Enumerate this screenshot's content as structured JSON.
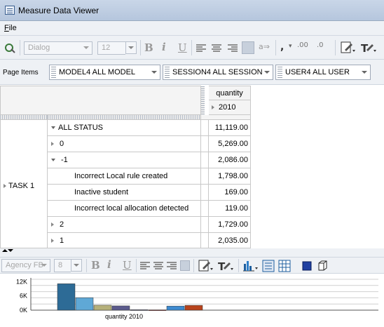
{
  "window": {
    "title": "Measure Data Viewer",
    "icon": "measure-viewer-icon"
  },
  "menu": {
    "file": "File"
  },
  "toolbar": {
    "font_name": "Dialog",
    "font_size": "12",
    "bold": "B",
    "italic": "i",
    "underline": "U"
  },
  "page_items": {
    "label": "Page Items",
    "model": "MODEL4  ALL MODEL",
    "session": "SESSION4  ALL SESSION",
    "user": "USER4  ALL USER"
  },
  "grid": {
    "measure": "quantity",
    "year": "2010",
    "task": "TASK 1",
    "rows": [
      {
        "label": "ALL STATUS",
        "value": "11,119.00"
      },
      {
        "label": "0",
        "value": "5,269.00"
      },
      {
        "label": "-1",
        "value": "2,086.00"
      },
      {
        "label": "Incorrect Local rule created",
        "value": "1,798.00"
      },
      {
        "label": "Inactive student",
        "value": "169.00"
      },
      {
        "label": "Incorrect local allocation detected",
        "value": "119.00"
      },
      {
        "label": "2",
        "value": "1,729.00"
      },
      {
        "label": "1",
        "value": "2,035.00"
      }
    ]
  },
  "chart_toolbar": {
    "font_name": "Agency FB",
    "font_size": "8",
    "bold": "B",
    "italic": "i",
    "underline": "U"
  },
  "chart_data": {
    "type": "bar",
    "xlabel": "quantity 2010",
    "ylabel": "",
    "yticks": [
      "12K",
      "6K",
      "0K"
    ],
    "ylim": [
      0,
      13000
    ],
    "grid": true,
    "categories": [
      "ALL STATUS",
      "0",
      "-1",
      "Incorrect Local rule created",
      "Inactive student",
      "Incorrect local allocation detected",
      "2",
      "1"
    ],
    "values": [
      11119,
      5269,
      2086,
      1798,
      169,
      119,
      1729,
      2035
    ],
    "colors": [
      "#2d6b96",
      "#5fa8d6",
      "#b5b07a",
      "#5b5a8c",
      "#2c2c4e",
      "#7a2020",
      "#3d8ad0",
      "#b8431c"
    ]
  }
}
